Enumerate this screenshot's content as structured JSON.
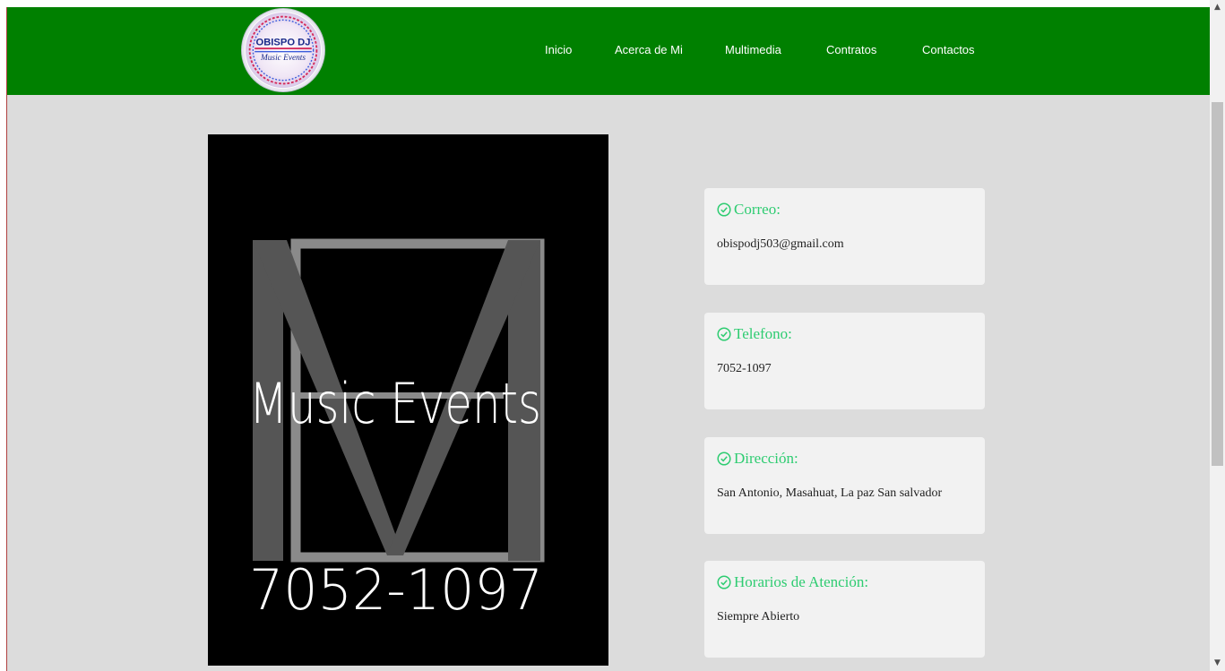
{
  "logo": {
    "line1": "OBISPO DJ",
    "line2": "Music Events"
  },
  "nav": [
    "Inicio",
    "Acerca de Mi",
    "Multimedia",
    "Contratos",
    "Contactos"
  ],
  "poster": {
    "letters": "M",
    "title": "Music Events",
    "phone": "7052-1097"
  },
  "contacts": [
    {
      "label": "Correo:",
      "value": "obispodj503@gmail.com"
    },
    {
      "label": "Telefono:",
      "value": "7052-1097"
    },
    {
      "label": "Dirección:",
      "value": "San Antonio, Masahuat, La paz San salvador"
    },
    {
      "label": "Horarios de Atención:",
      "value": "Siempre Abierto"
    }
  ],
  "colors": {
    "navbar": "#008000",
    "accent": "#2ecc71",
    "page_bg": "#dcdcdc",
    "card_bg": "#f2f2f2"
  },
  "icons": {
    "check": "check-circle-icon",
    "scroll_up": "chevron-up-icon",
    "scroll_down": "chevron-down-icon"
  }
}
